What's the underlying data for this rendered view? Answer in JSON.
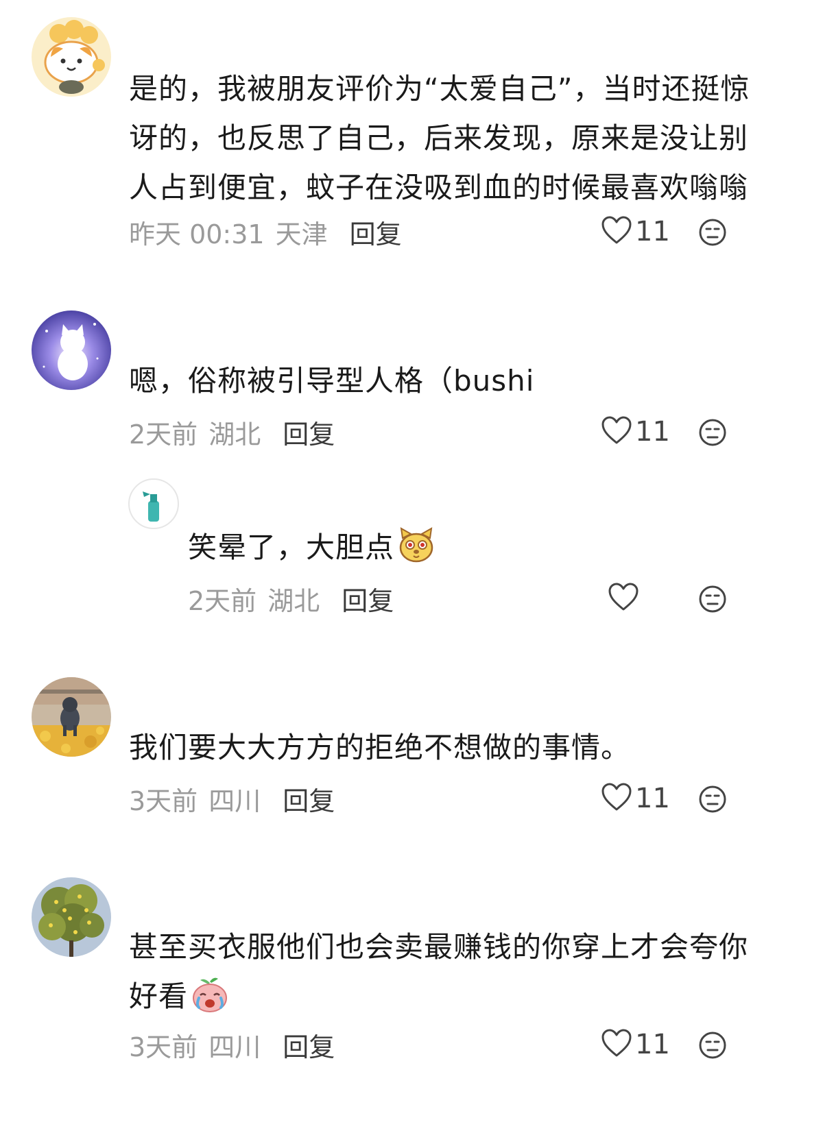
{
  "comments": [
    {
      "text_lines": [
        "是的，我被朋友评价为“太爱自己”，当时还挺惊",
        "讶的，也反思了自己，后来发现，原来是没让别",
        "人占到便宜，蚊子在没吸到血的时候最喜欢嗡嗡"
      ],
      "time": "昨天 00:31",
      "location": "天津",
      "reply_label": "回复",
      "likes": "11"
    },
    {
      "text": "嗯，俗称被引导型人格（bushi",
      "time": "2天前",
      "location": "湖北",
      "reply_label": "回复",
      "likes": "11"
    },
    {
      "text": "笑晕了，大胆点",
      "emoji": "dog-face-emoji",
      "time": "2天前",
      "location": "湖北",
      "reply_label": "回复",
      "likes": ""
    },
    {
      "text": "我们要大大方方的拒绝不想做的事情。",
      "time": "3天前",
      "location": "四川",
      "reply_label": "回复",
      "likes": "11"
    },
    {
      "text_lines": [
        "甚至买衣服他们也会卖最赚钱的你穿上才会夸你",
        "好看"
      ],
      "emoji": "crying-peach-emoji",
      "time": "3天前",
      "location": "四川",
      "reply_label": "回复",
      "likes": "11"
    }
  ],
  "icons": {
    "like": "heart-outline-icon",
    "dislike": "neutral-face-icon"
  },
  "colors": {
    "meta_text": "#9a9a9a",
    "reply_text": "#3a3a3a",
    "body_text": "#1a1a1a"
  }
}
